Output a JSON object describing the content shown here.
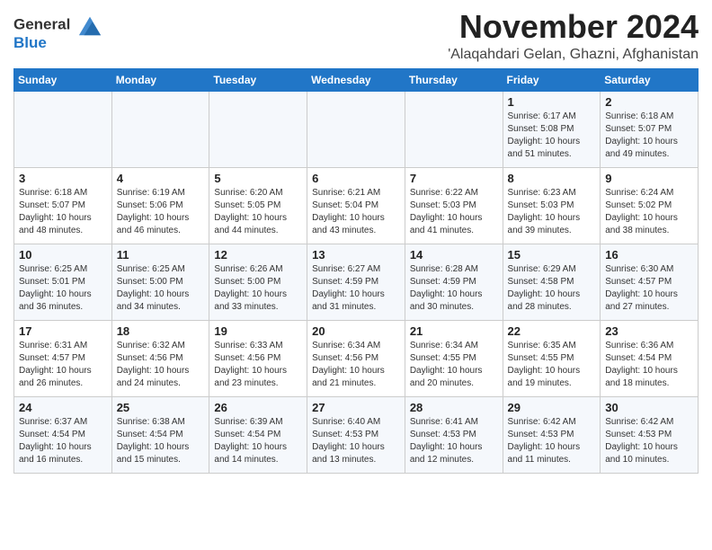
{
  "header": {
    "logo_line1": "General",
    "logo_line2": "Blue",
    "month": "November 2024",
    "location": "'Alaqahdari Gelan, Ghazni, Afghanistan"
  },
  "weekdays": [
    "Sunday",
    "Monday",
    "Tuesday",
    "Wednesday",
    "Thursday",
    "Friday",
    "Saturday"
  ],
  "weeks": [
    [
      {
        "day": "",
        "info": ""
      },
      {
        "day": "",
        "info": ""
      },
      {
        "day": "",
        "info": ""
      },
      {
        "day": "",
        "info": ""
      },
      {
        "day": "",
        "info": ""
      },
      {
        "day": "1",
        "info": "Sunrise: 6:17 AM\nSunset: 5:08 PM\nDaylight: 10 hours\nand 51 minutes."
      },
      {
        "day": "2",
        "info": "Sunrise: 6:18 AM\nSunset: 5:07 PM\nDaylight: 10 hours\nand 49 minutes."
      }
    ],
    [
      {
        "day": "3",
        "info": "Sunrise: 6:18 AM\nSunset: 5:07 PM\nDaylight: 10 hours\nand 48 minutes."
      },
      {
        "day": "4",
        "info": "Sunrise: 6:19 AM\nSunset: 5:06 PM\nDaylight: 10 hours\nand 46 minutes."
      },
      {
        "day": "5",
        "info": "Sunrise: 6:20 AM\nSunset: 5:05 PM\nDaylight: 10 hours\nand 44 minutes."
      },
      {
        "day": "6",
        "info": "Sunrise: 6:21 AM\nSunset: 5:04 PM\nDaylight: 10 hours\nand 43 minutes."
      },
      {
        "day": "7",
        "info": "Sunrise: 6:22 AM\nSunset: 5:03 PM\nDaylight: 10 hours\nand 41 minutes."
      },
      {
        "day": "8",
        "info": "Sunrise: 6:23 AM\nSunset: 5:03 PM\nDaylight: 10 hours\nand 39 minutes."
      },
      {
        "day": "9",
        "info": "Sunrise: 6:24 AM\nSunset: 5:02 PM\nDaylight: 10 hours\nand 38 minutes."
      }
    ],
    [
      {
        "day": "10",
        "info": "Sunrise: 6:25 AM\nSunset: 5:01 PM\nDaylight: 10 hours\nand 36 minutes."
      },
      {
        "day": "11",
        "info": "Sunrise: 6:25 AM\nSunset: 5:00 PM\nDaylight: 10 hours\nand 34 minutes."
      },
      {
        "day": "12",
        "info": "Sunrise: 6:26 AM\nSunset: 5:00 PM\nDaylight: 10 hours\nand 33 minutes."
      },
      {
        "day": "13",
        "info": "Sunrise: 6:27 AM\nSunset: 4:59 PM\nDaylight: 10 hours\nand 31 minutes."
      },
      {
        "day": "14",
        "info": "Sunrise: 6:28 AM\nSunset: 4:59 PM\nDaylight: 10 hours\nand 30 minutes."
      },
      {
        "day": "15",
        "info": "Sunrise: 6:29 AM\nSunset: 4:58 PM\nDaylight: 10 hours\nand 28 minutes."
      },
      {
        "day": "16",
        "info": "Sunrise: 6:30 AM\nSunset: 4:57 PM\nDaylight: 10 hours\nand 27 minutes."
      }
    ],
    [
      {
        "day": "17",
        "info": "Sunrise: 6:31 AM\nSunset: 4:57 PM\nDaylight: 10 hours\nand 26 minutes."
      },
      {
        "day": "18",
        "info": "Sunrise: 6:32 AM\nSunset: 4:56 PM\nDaylight: 10 hours\nand 24 minutes."
      },
      {
        "day": "19",
        "info": "Sunrise: 6:33 AM\nSunset: 4:56 PM\nDaylight: 10 hours\nand 23 minutes."
      },
      {
        "day": "20",
        "info": "Sunrise: 6:34 AM\nSunset: 4:56 PM\nDaylight: 10 hours\nand 21 minutes."
      },
      {
        "day": "21",
        "info": "Sunrise: 6:34 AM\nSunset: 4:55 PM\nDaylight: 10 hours\nand 20 minutes."
      },
      {
        "day": "22",
        "info": "Sunrise: 6:35 AM\nSunset: 4:55 PM\nDaylight: 10 hours\nand 19 minutes."
      },
      {
        "day": "23",
        "info": "Sunrise: 6:36 AM\nSunset: 4:54 PM\nDaylight: 10 hours\nand 18 minutes."
      }
    ],
    [
      {
        "day": "24",
        "info": "Sunrise: 6:37 AM\nSunset: 4:54 PM\nDaylight: 10 hours\nand 16 minutes."
      },
      {
        "day": "25",
        "info": "Sunrise: 6:38 AM\nSunset: 4:54 PM\nDaylight: 10 hours\nand 15 minutes."
      },
      {
        "day": "26",
        "info": "Sunrise: 6:39 AM\nSunset: 4:54 PM\nDaylight: 10 hours\nand 14 minutes."
      },
      {
        "day": "27",
        "info": "Sunrise: 6:40 AM\nSunset: 4:53 PM\nDaylight: 10 hours\nand 13 minutes."
      },
      {
        "day": "28",
        "info": "Sunrise: 6:41 AM\nSunset: 4:53 PM\nDaylight: 10 hours\nand 12 minutes."
      },
      {
        "day": "29",
        "info": "Sunrise: 6:42 AM\nSunset: 4:53 PM\nDaylight: 10 hours\nand 11 minutes."
      },
      {
        "day": "30",
        "info": "Sunrise: 6:42 AM\nSunset: 4:53 PM\nDaylight: 10 hours\nand 10 minutes."
      }
    ]
  ]
}
